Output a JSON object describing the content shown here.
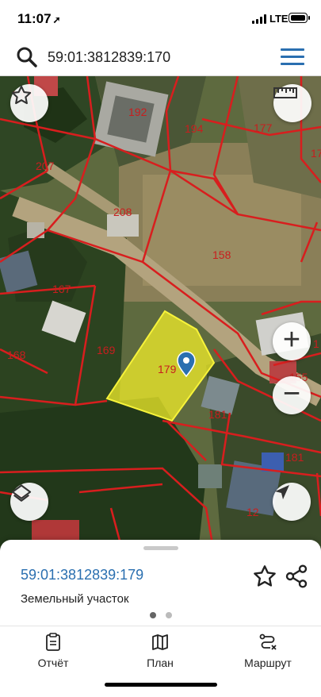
{
  "status_bar": {
    "time": "11:07",
    "network": "LTE"
  },
  "search": {
    "query": "59:01:3812839:170"
  },
  "map": {
    "plot_labels": [
      "139",
      "192",
      "194",
      "177",
      "17",
      "207",
      "208",
      "158",
      "167",
      "169",
      "168",
      "179",
      "155",
      "181",
      "181",
      "12",
      "1"
    ],
    "selected_plot": "179",
    "colors": {
      "boundary": "#d81e1e",
      "selection": "#f2ee2a",
      "marker": "#2a6fb0"
    }
  },
  "controls": {
    "favorite_icon": "star-icon",
    "ruler_icon": "ruler-icon",
    "zoom_in": "+",
    "zoom_out": "−",
    "layers_icon": "layers-icon",
    "locate_icon": "location-arrow-icon"
  },
  "sheet": {
    "parcel_id": "59:01:3812839:179",
    "parcel_type": "Земельный участок",
    "page_count": 2,
    "active_page": 1
  },
  "tabs": [
    {
      "label": "Отчёт",
      "icon": "report-icon"
    },
    {
      "label": "План",
      "icon": "map-icon"
    },
    {
      "label": "Маршрут",
      "icon": "route-icon"
    }
  ]
}
